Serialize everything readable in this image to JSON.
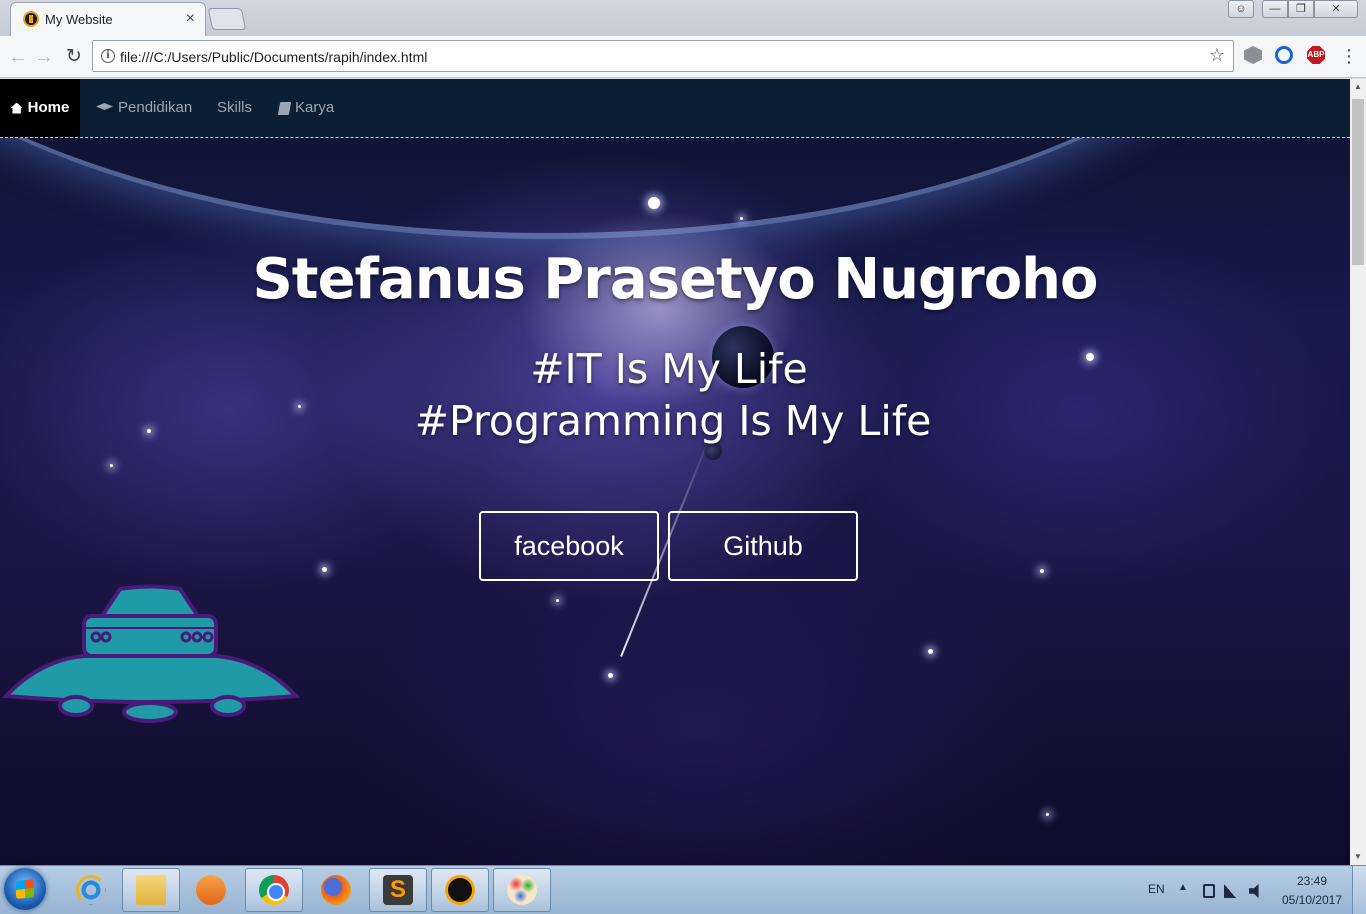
{
  "browser": {
    "tab_title": "My Website",
    "tab_close": "×",
    "url": "file:///C:/Users/Public/Documents/rapih/index.html",
    "extensions": [
      "puzzle-extension-icon",
      "blue-ring-extension-icon",
      "abp-extension-icon"
    ],
    "abp_label": "ABP"
  },
  "navbar": {
    "items": [
      {
        "label": "Home",
        "icon": "home-icon",
        "active": true
      },
      {
        "label": "Pendidikan",
        "icon": "graduation-cap-icon"
      },
      {
        "label": "Skills"
      },
      {
        "label": "Karya",
        "icon": "book-icon"
      }
    ]
  },
  "hero": {
    "name": "Stefanus Prasetyo Nugroho",
    "tagline_1": "#IT Is My Life",
    "tagline_2": "#Programming Is My Life",
    "buttons": [
      {
        "label": "facebook"
      },
      {
        "label": "Github"
      }
    ]
  },
  "colors": {
    "navbar_bg": "#0c1e33",
    "nav_active_bg": "#000000",
    "ufo_body": "#1f9aa6",
    "ufo_outline": "#4a1a7a"
  },
  "taskbar": {
    "apps": [
      "internet-explorer-icon",
      "file-explorer-icon",
      "media-player-icon",
      "chrome-icon",
      "firefox-icon",
      "sublime-text-icon",
      "aimp-icon",
      "paint-icon"
    ],
    "sublime_glyph": "S",
    "language": "EN",
    "time": "23:49",
    "date": "05/10/2017"
  }
}
